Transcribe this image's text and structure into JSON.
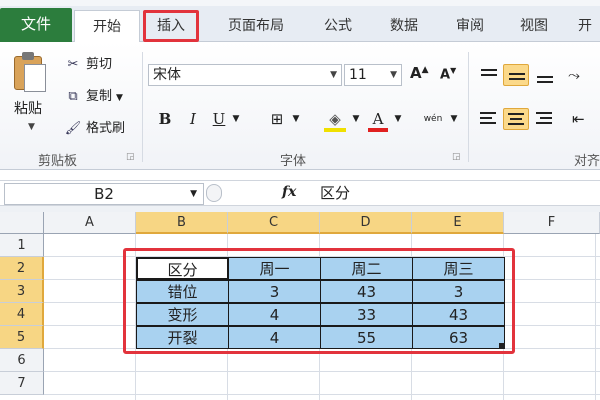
{
  "ribbon_tabs": [
    "文件",
    "开始",
    "插入",
    "页面布局",
    "公式",
    "数据",
    "审阅",
    "视图",
    "开"
  ],
  "clipboard": {
    "paste_label": "粘贴",
    "cut_label": "剪切",
    "copy_label": "复制",
    "format_painter_label": "格式刷",
    "group_label": "剪贴板"
  },
  "font": {
    "name": "宋体",
    "size": "11",
    "group_label": "字体",
    "grow_label": "A",
    "shrink_label": "A",
    "bold": "B",
    "italic": "I",
    "underline": "U",
    "font_color_label": "A",
    "phonetic_label": "wén"
  },
  "alignment": {
    "group_label": "对齐"
  },
  "formula_bar": {
    "name_box": "B2",
    "fx_label": "fx",
    "formula": "区分"
  },
  "columns": [
    "A",
    "B",
    "C",
    "D",
    "E",
    "F"
  ],
  "selected_columns": [
    "B",
    "C",
    "D",
    "E"
  ],
  "rows": [
    "1",
    "2",
    "3",
    "4",
    "5",
    "6",
    "7"
  ],
  "selected_rows": [
    "2",
    "3",
    "4",
    "5"
  ],
  "table": {
    "header": [
      "区分",
      "周一",
      "周二",
      "周三"
    ],
    "rows": [
      [
        "错位",
        "3",
        "43",
        "3"
      ],
      [
        "变形",
        "4",
        "33",
        "43"
      ],
      [
        "开裂",
        "4",
        "55",
        "63"
      ]
    ]
  },
  "colors": {
    "selection_fill": "#a9d2f0",
    "highlight_outline": "#e2333c",
    "file_tab": "#2c7d3d",
    "header_selected": "#f7d684"
  }
}
